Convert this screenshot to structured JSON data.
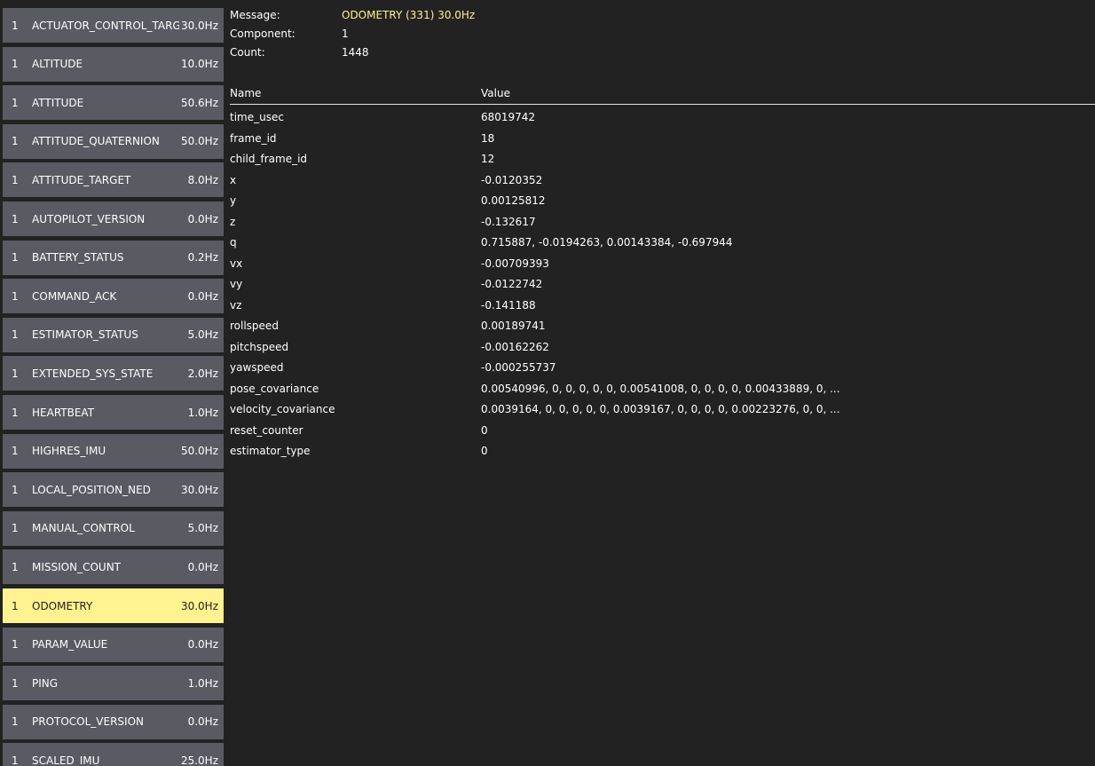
{
  "colors": {
    "background": "#222222",
    "button": "#5a5a62",
    "selected": "#fff291",
    "accent": "#fff291"
  },
  "messages": [
    {
      "component": "1",
      "name": "ACTUATOR_CONTROL_TARGET",
      "rate": "30.0Hz"
    },
    {
      "component": "1",
      "name": "ALTITUDE",
      "rate": "10.0Hz"
    },
    {
      "component": "1",
      "name": "ATTITUDE",
      "rate": "50.6Hz"
    },
    {
      "component": "1",
      "name": "ATTITUDE_QUATERNION",
      "rate": "50.0Hz"
    },
    {
      "component": "1",
      "name": "ATTITUDE_TARGET",
      "rate": "8.0Hz"
    },
    {
      "component": "1",
      "name": "AUTOPILOT_VERSION",
      "rate": "0.0Hz"
    },
    {
      "component": "1",
      "name": "BATTERY_STATUS",
      "rate": "0.2Hz"
    },
    {
      "component": "1",
      "name": "COMMAND_ACK",
      "rate": "0.0Hz"
    },
    {
      "component": "1",
      "name": "ESTIMATOR_STATUS",
      "rate": "5.0Hz"
    },
    {
      "component": "1",
      "name": "EXTENDED_SYS_STATE",
      "rate": "2.0Hz"
    },
    {
      "component": "1",
      "name": "HEARTBEAT",
      "rate": "1.0Hz"
    },
    {
      "component": "1",
      "name": "HIGHRES_IMU",
      "rate": "50.0Hz"
    },
    {
      "component": "1",
      "name": "LOCAL_POSITION_NED",
      "rate": "30.0Hz"
    },
    {
      "component": "1",
      "name": "MANUAL_CONTROL",
      "rate": "5.0Hz"
    },
    {
      "component": "1",
      "name": "MISSION_COUNT",
      "rate": "0.0Hz"
    },
    {
      "component": "1",
      "name": "ODOMETRY",
      "rate": "30.0Hz",
      "selected": true
    },
    {
      "component": "1",
      "name": "PARAM_VALUE",
      "rate": "0.0Hz"
    },
    {
      "component": "1",
      "name": "PING",
      "rate": "1.0Hz"
    },
    {
      "component": "1",
      "name": "PROTOCOL_VERSION",
      "rate": "0.0Hz"
    },
    {
      "component": "1",
      "name": "SCALED_IMU",
      "rate": "25.0Hz"
    }
  ],
  "detail": {
    "message_label": "Message:",
    "message_value": "ODOMETRY (331) 30.0Hz",
    "component_label": "Component:",
    "component_value": "1",
    "count_label": "Count:",
    "count_value": "1448",
    "header_name": "Name",
    "header_value": "Value",
    "fields": [
      {
        "name": "time_usec",
        "value": "68019742"
      },
      {
        "name": "frame_id",
        "value": "18"
      },
      {
        "name": "child_frame_id",
        "value": "12"
      },
      {
        "name": "x",
        "value": "-0.0120352"
      },
      {
        "name": "y",
        "value": "0.00125812"
      },
      {
        "name": "z",
        "value": "-0.132617"
      },
      {
        "name": "q",
        "value": "0.715887, -0.0194263, 0.00143384, -0.697944"
      },
      {
        "name": "vx",
        "value": "-0.00709393"
      },
      {
        "name": "vy",
        "value": "-0.0122742"
      },
      {
        "name": "vz",
        "value": "-0.141188"
      },
      {
        "name": "rollspeed",
        "value": "0.00189741"
      },
      {
        "name": "pitchspeed",
        "value": "-0.00162262"
      },
      {
        "name": "yawspeed",
        "value": "-0.000255737"
      },
      {
        "name": "pose_covariance",
        "value": "0.00540996, 0, 0, 0, 0, 0, 0.00541008, 0, 0, 0, 0, 0.00433889, 0, ..."
      },
      {
        "name": "velocity_covariance",
        "value": "0.0039164, 0, 0, 0, 0, 0, 0.0039167, 0, 0, 0, 0, 0.00223276, 0, 0, ..."
      },
      {
        "name": "reset_counter",
        "value": "0"
      },
      {
        "name": "estimator_type",
        "value": "0"
      }
    ]
  }
}
